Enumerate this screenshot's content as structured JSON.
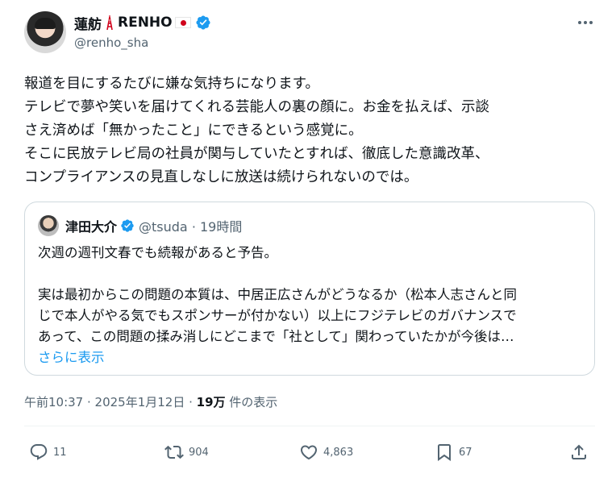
{
  "author": {
    "display_name": "蓮舫",
    "display_name_suffix": "RENHO",
    "handle": "@renho_sha",
    "emoji_icons": [
      "tokyo-tower-icon",
      "japan-flag-icon"
    ],
    "verified_icon": "verified-badge-icon"
  },
  "post": {
    "lines": [
      "報道を目にするたびに嫌な気持ちになります。",
      "テレビで夢や笑いを届けてくれる芸能人の裏の顔に。お金を払えば、示談",
      "さえ済めば「無かったこと」にできるという感覚に。",
      "そこに民放テレビ局の社員が関与していたとすれば、徹底した意識改革、",
      "コンプライアンスの見直しなしに放送は続けられないのでは。"
    ]
  },
  "quote": {
    "name": "津田大介",
    "handle_meta": "@tsuda · 19時間",
    "lines": [
      "次週の週刊文春でも続報があると予告。",
      "",
      "実は最初からこの問題の本質は、中居正広さんがどうなるか（松本人志さんと同",
      "じで本人がやる気でもスポンサーが付かない）以上にフジテレビのガバナンスで",
      "あって、この問題の揉み消しにどこまで「社として」関わっていたかが今後は…"
    ],
    "show_more": "さらに表示"
  },
  "meta": {
    "timestamp": "午前10:37 · 2025年1月12日 · ",
    "views_count": "19万",
    "views_label": " 件の表示"
  },
  "actions": {
    "replies": "11",
    "reposts": "904",
    "likes": "4,863",
    "bookmarks": "67"
  },
  "colors": {
    "text": "#0f1419",
    "secondary": "#536471",
    "accent": "#1d9bf0",
    "border": "#cfd9de"
  }
}
